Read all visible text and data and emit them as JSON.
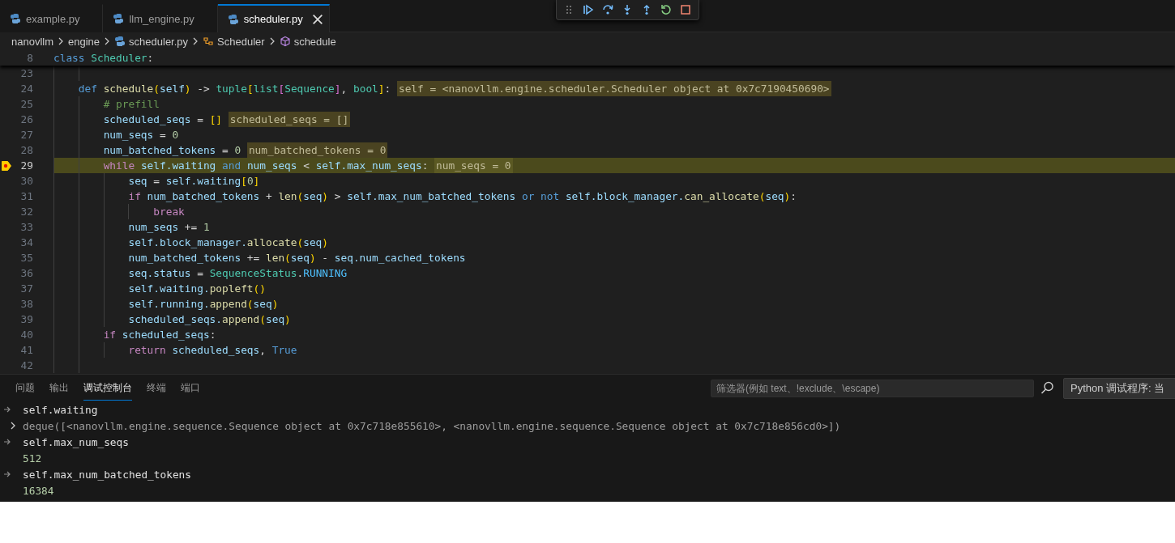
{
  "tabs": [
    {
      "label": "example.py",
      "selected": false
    },
    {
      "label": "llm_engine.py",
      "selected": false
    },
    {
      "label": "scheduler.py",
      "selected": true
    }
  ],
  "breadcrumb": [
    {
      "label": "nanovllm",
      "kind": "folder"
    },
    {
      "label": "engine",
      "kind": "folder"
    },
    {
      "label": "scheduler.py",
      "kind": "file"
    },
    {
      "label": "Scheduler",
      "kind": "class"
    },
    {
      "label": "schedule",
      "kind": "method"
    }
  ],
  "sticky_line": {
    "number": "8",
    "tokens": [
      {
        "kind": "kw",
        "text": "class "
      },
      {
        "kind": "cls",
        "text": "Scheduler"
      },
      {
        "kind": "op",
        "text": ":"
      }
    ]
  },
  "code_lines": [
    {
      "number": "23",
      "current": false
    },
    {
      "number": "24",
      "current": false,
      "tokens": [
        {
          "kind": "kw",
          "text": "    def "
        },
        {
          "kind": "fn",
          "text": "schedule"
        },
        {
          "kind": "b1",
          "text": "("
        },
        {
          "kind": "var",
          "text": "self"
        },
        {
          "kind": "b1",
          "text": ")"
        },
        {
          "kind": "op",
          "text": " -> "
        },
        {
          "kind": "cls",
          "text": "tuple"
        },
        {
          "kind": "b1",
          "text": "["
        },
        {
          "kind": "cls",
          "text": "list"
        },
        {
          "kind": "b2",
          "text": "["
        },
        {
          "kind": "cls",
          "text": "Sequence"
        },
        {
          "kind": "b2",
          "text": "]"
        },
        {
          "kind": "op",
          "text": ", "
        },
        {
          "kind": "cls",
          "text": "bool"
        },
        {
          "kind": "b1",
          "text": "]"
        },
        {
          "kind": "op",
          "text": ":"
        }
      ],
      "inline_value": "self = <nanovllm.engine.scheduler.Scheduler object at 0x7c7190450690>"
    },
    {
      "number": "25",
      "current": false,
      "tokens": [
        {
          "kind": "cm",
          "text": "        # prefill"
        }
      ]
    },
    {
      "number": "26",
      "current": false,
      "tokens": [
        {
          "kind": "var",
          "text": "        scheduled_seqs"
        },
        {
          "kind": "op",
          "text": " = "
        },
        {
          "kind": "b1",
          "text": "[]"
        }
      ],
      "inline_value": "scheduled_seqs = []"
    },
    {
      "number": "27",
      "current": false,
      "tokens": [
        {
          "kind": "var",
          "text": "        num_seqs"
        },
        {
          "kind": "op",
          "text": " = "
        },
        {
          "kind": "num",
          "text": "0"
        }
      ]
    },
    {
      "number": "28",
      "current": false,
      "tokens": [
        {
          "kind": "var",
          "text": "        num_batched_tokens"
        },
        {
          "kind": "op",
          "text": " = "
        },
        {
          "kind": "num",
          "text": "0"
        }
      ],
      "inline_value": "num_batched_tokens = 0"
    },
    {
      "number": "29",
      "current": true,
      "tokens": [
        {
          "kind": "ctl",
          "text": "        while "
        },
        {
          "kind": "var",
          "text": "self.waiting "
        },
        {
          "kind": "kw",
          "text": "and "
        },
        {
          "kind": "var",
          "text": "num_seqs"
        },
        {
          "kind": "op",
          "text": " < "
        },
        {
          "kind": "var",
          "text": "self.max_num_seqs"
        },
        {
          "kind": "op",
          "text": ":"
        }
      ],
      "inline_value": "num_seqs = 0"
    },
    {
      "number": "30",
      "current": false,
      "tokens": [
        {
          "kind": "var",
          "text": "            seq"
        },
        {
          "kind": "op",
          "text": " = "
        },
        {
          "kind": "var",
          "text": "self.waiting"
        },
        {
          "kind": "b1",
          "text": "["
        },
        {
          "kind": "num",
          "text": "0"
        },
        {
          "kind": "b1",
          "text": "]"
        }
      ]
    },
    {
      "number": "31",
      "current": false,
      "tokens": [
        {
          "kind": "ctl",
          "text": "            if "
        },
        {
          "kind": "var",
          "text": "num_batched_tokens"
        },
        {
          "kind": "op",
          "text": " + "
        },
        {
          "kind": "fn",
          "text": "len"
        },
        {
          "kind": "b1",
          "text": "("
        },
        {
          "kind": "var",
          "text": "seq"
        },
        {
          "kind": "b1",
          "text": ")"
        },
        {
          "kind": "op",
          "text": " > "
        },
        {
          "kind": "var",
          "text": "self.max_num_batched_tokens "
        },
        {
          "kind": "kw",
          "text": "or not "
        },
        {
          "kind": "var",
          "text": "self.block_manager."
        },
        {
          "kind": "fn",
          "text": "can_allocate"
        },
        {
          "kind": "b1",
          "text": "("
        },
        {
          "kind": "var",
          "text": "seq"
        },
        {
          "kind": "b1",
          "text": ")"
        },
        {
          "kind": "op",
          "text": ":"
        }
      ]
    },
    {
      "number": "32",
      "current": false,
      "tokens": [
        {
          "kind": "ctl",
          "text": "                break"
        }
      ]
    },
    {
      "number": "33",
      "current": false,
      "tokens": [
        {
          "kind": "var",
          "text": "            num_seqs"
        },
        {
          "kind": "op",
          "text": " += "
        },
        {
          "kind": "num",
          "text": "1"
        }
      ]
    },
    {
      "number": "34",
      "current": false,
      "tokens": [
        {
          "kind": "var",
          "text": "            self.block_manager."
        },
        {
          "kind": "fn",
          "text": "allocate"
        },
        {
          "kind": "b1",
          "text": "("
        },
        {
          "kind": "var",
          "text": "seq"
        },
        {
          "kind": "b1",
          "text": ")"
        }
      ]
    },
    {
      "number": "35",
      "current": false,
      "tokens": [
        {
          "kind": "var",
          "text": "            num_batched_tokens"
        },
        {
          "kind": "op",
          "text": " += "
        },
        {
          "kind": "fn",
          "text": "len"
        },
        {
          "kind": "b1",
          "text": "("
        },
        {
          "kind": "var",
          "text": "seq"
        },
        {
          "kind": "b1",
          "text": ")"
        },
        {
          "kind": "op",
          "text": " - "
        },
        {
          "kind": "var",
          "text": "seq.num_cached_tokens"
        }
      ]
    },
    {
      "number": "36",
      "current": false,
      "tokens": [
        {
          "kind": "var",
          "text": "            seq.status"
        },
        {
          "kind": "op",
          "text": " = "
        },
        {
          "kind": "cls",
          "text": "SequenceStatus"
        },
        {
          "kind": "op",
          "text": "."
        },
        {
          "kind": "const",
          "text": "RUNNING"
        }
      ]
    },
    {
      "number": "37",
      "current": false,
      "tokens": [
        {
          "kind": "var",
          "text": "            self.waiting."
        },
        {
          "kind": "fn",
          "text": "popleft"
        },
        {
          "kind": "b1",
          "text": "()"
        }
      ]
    },
    {
      "number": "38",
      "current": false,
      "tokens": [
        {
          "kind": "var",
          "text": "            self.running."
        },
        {
          "kind": "fn",
          "text": "append"
        },
        {
          "kind": "b1",
          "text": "("
        },
        {
          "kind": "var",
          "text": "seq"
        },
        {
          "kind": "b1",
          "text": ")"
        }
      ]
    },
    {
      "number": "39",
      "current": false,
      "tokens": [
        {
          "kind": "var",
          "text": "            scheduled_seqs."
        },
        {
          "kind": "fn",
          "text": "append"
        },
        {
          "kind": "b1",
          "text": "("
        },
        {
          "kind": "var",
          "text": "seq"
        },
        {
          "kind": "b1",
          "text": ")"
        }
      ]
    },
    {
      "number": "40",
      "current": false,
      "tokens": [
        {
          "kind": "ctl",
          "text": "        if "
        },
        {
          "kind": "var",
          "text": "scheduled_seqs"
        },
        {
          "kind": "op",
          "text": ":"
        }
      ]
    },
    {
      "number": "41",
      "current": false,
      "tokens": [
        {
          "kind": "ctl",
          "text": "            return "
        },
        {
          "kind": "var",
          "text": "scheduled_seqs"
        },
        {
          "kind": "op",
          "text": ", "
        },
        {
          "kind": "kw",
          "text": "True"
        }
      ]
    },
    {
      "number": "42",
      "current": false
    }
  ],
  "panel": {
    "tabs": [
      {
        "label": "问题",
        "selected": false
      },
      {
        "label": "输出",
        "selected": false
      },
      {
        "label": "调试控制台",
        "selected": true
      },
      {
        "label": "终端",
        "selected": false
      },
      {
        "label": "端口",
        "selected": false
      }
    ],
    "filter": {
      "placeholder": "筛选器(例如 text、!exclude、\\escape)"
    },
    "session_select": "Python 调试程序: 当",
    "console": [
      {
        "kind": "input",
        "text": "self.waiting"
      },
      {
        "kind": "object",
        "expanded": false,
        "text": "deque([<nanovllm.engine.sequence.Sequence object at 0x7c718e855610>, <nanovllm.engine.sequence.Sequence object at 0x7c718e856cd0>])"
      },
      {
        "kind": "input",
        "text": "self.max_num_seqs"
      },
      {
        "kind": "result",
        "text": "512"
      },
      {
        "kind": "input",
        "text": "self.max_num_batched_tokens"
      },
      {
        "kind": "result",
        "text": "16384"
      }
    ]
  }
}
